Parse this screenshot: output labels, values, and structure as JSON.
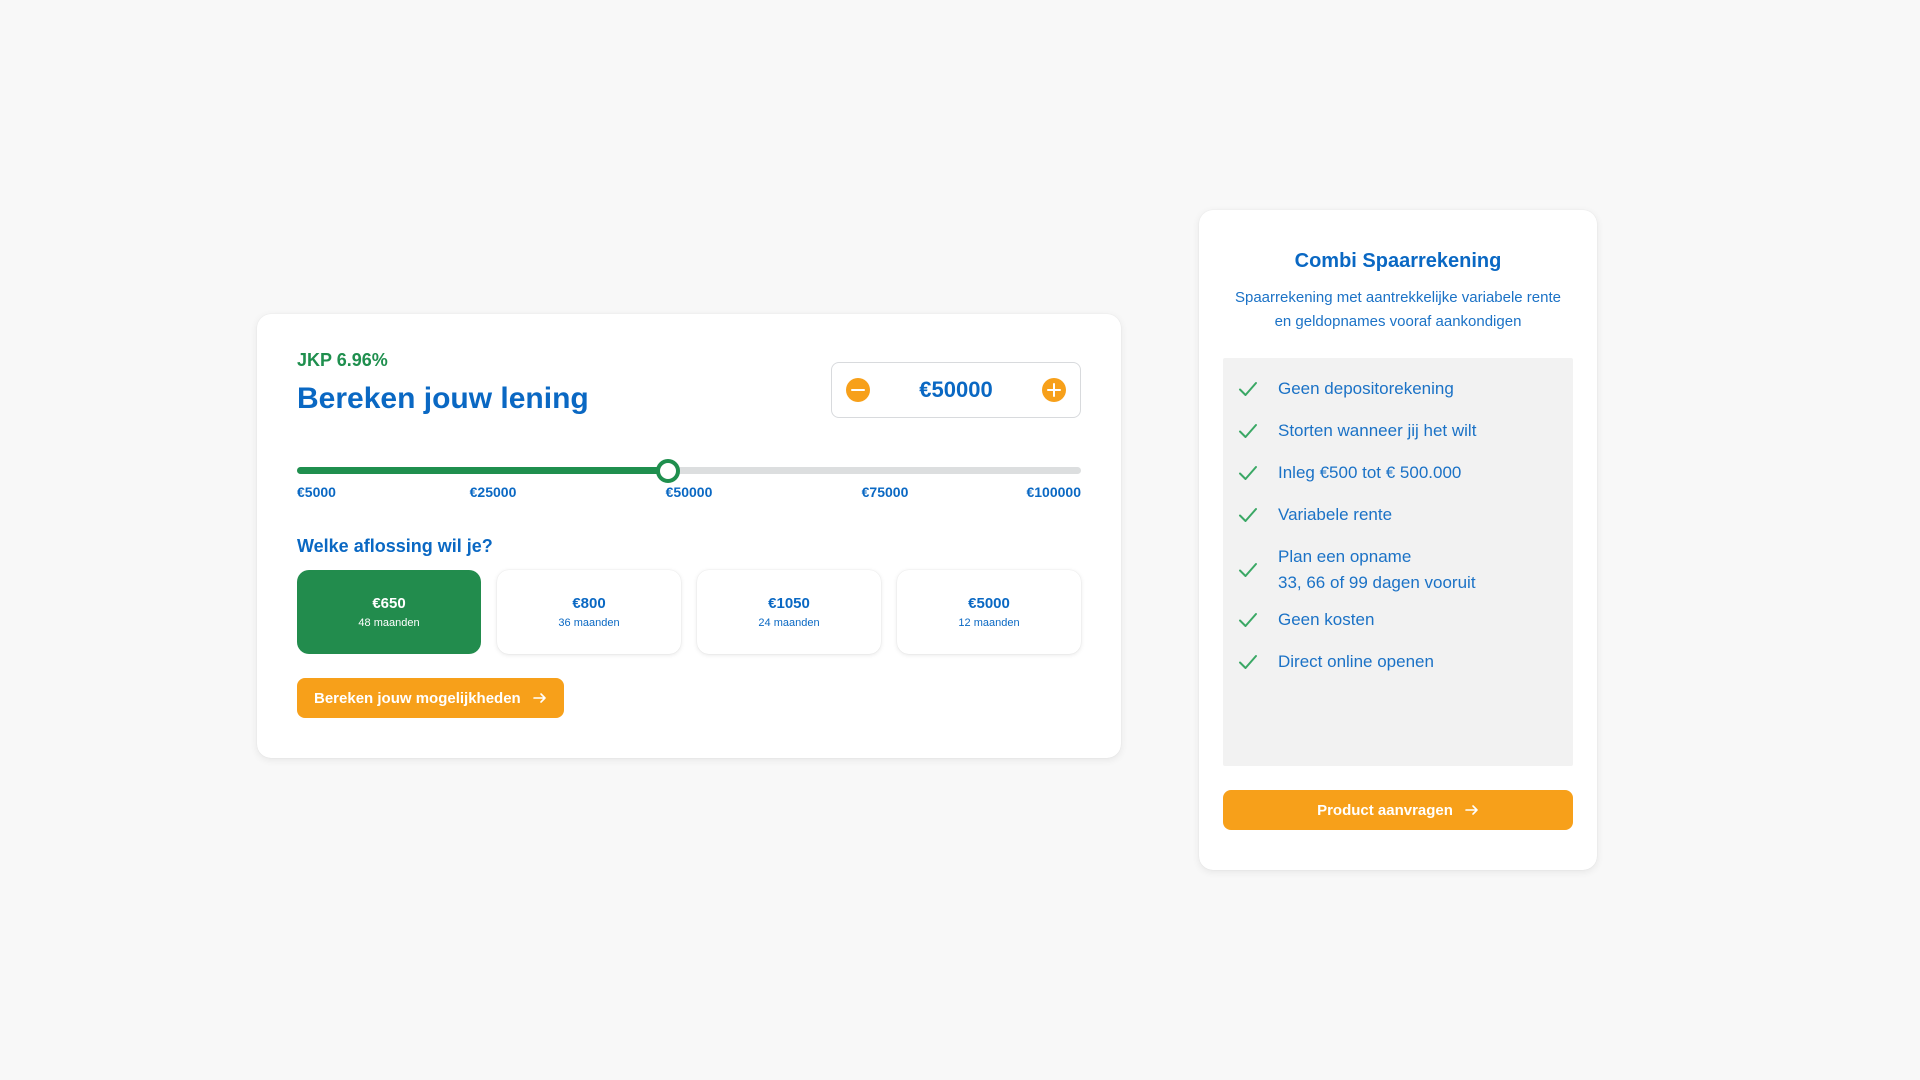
{
  "loan": {
    "jkp": "JKP 6.96%",
    "title": "Bereken jouw lening",
    "amount": "€50000",
    "slider": {
      "min": 5000,
      "max": 100000,
      "value": 50000,
      "ticks": [
        "€5000",
        "€25000",
        "€50000",
        "€75000",
        "€100000"
      ]
    },
    "question": "Welke aflossing wil je?",
    "options": [
      {
        "amount": "€650",
        "duration": "48 maanden",
        "selected": true
      },
      {
        "amount": "€800",
        "duration": "36 maanden",
        "selected": false
      },
      {
        "amount": "€1050",
        "duration": "24 maanden",
        "selected": false
      },
      {
        "amount": "€5000",
        "duration": "12 maanden",
        "selected": false
      }
    ],
    "button_label": "Bereken jouw mogelijkheden"
  },
  "product": {
    "title": "Combi Spaarrekening",
    "description": "Spaarrekening met aantrekkelijke variabele rente en geldopnames vooraf aankondigen",
    "features": [
      [
        "Geen depositorekening"
      ],
      [
        "Storten wanneer jij het wilt"
      ],
      [
        "Inleg €500 tot € 500.000"
      ],
      [
        "Variabele rente"
      ],
      [
        "Plan een opname",
        "33, 66 of 99 dagen vooruit"
      ],
      [
        "Geen kosten"
      ],
      [
        "Direct online openen"
      ]
    ],
    "button_label": "Product aanvragen"
  },
  "colors": {
    "brand_blue": "#0a68c3",
    "brand_green": "#1f8f4e",
    "accent_orange": "#f7a01a",
    "background": "#f8f8f8"
  },
  "icons": {
    "minus": "minus-circle-icon",
    "plus": "plus-circle-icon",
    "arrow": "arrow-right-icon",
    "check": "check-icon"
  }
}
